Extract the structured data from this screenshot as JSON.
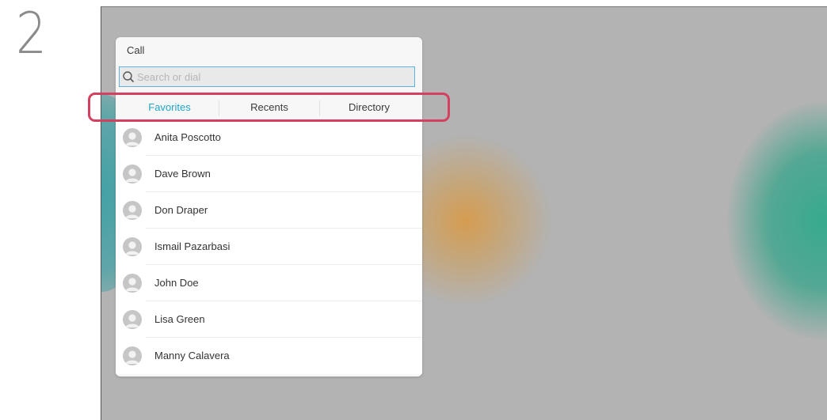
{
  "step": {
    "number": "2"
  },
  "call_panel": {
    "title": "Call",
    "search": {
      "placeholder": "Search or dial",
      "icon": "search-icon"
    },
    "tabs": [
      {
        "label": "Favorites",
        "active": true
      },
      {
        "label": "Recents",
        "active": false
      },
      {
        "label": "Directory",
        "active": false
      }
    ],
    "contacts": [
      {
        "name": "Anita Poscotto"
      },
      {
        "name": "Dave Brown"
      },
      {
        "name": "Don Draper"
      },
      {
        "name": "Ismail Pazarbasi"
      },
      {
        "name": "John Doe"
      },
      {
        "name": "Lisa Green"
      },
      {
        "name": "Manny Calavera"
      }
    ]
  },
  "colors": {
    "active_tab": "#1fa6c9",
    "highlight": "#d44060",
    "search_border": "#5fb3d9"
  }
}
